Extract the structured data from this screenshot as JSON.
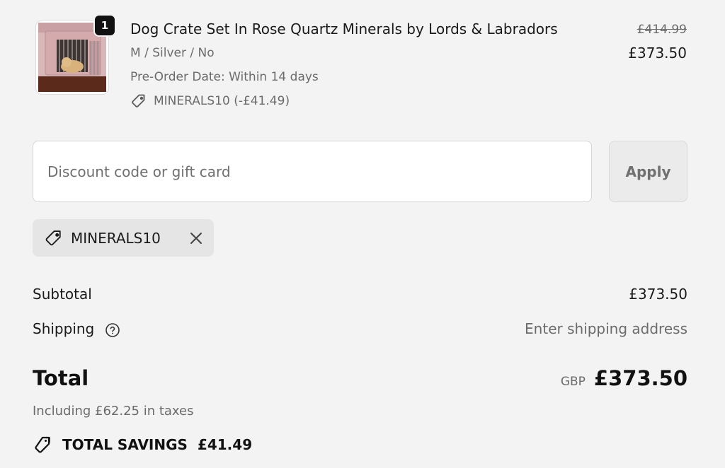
{
  "line_item": {
    "quantity": "1",
    "title": "Dog Crate Set In Rose Quartz Minerals by Lords & Labradors",
    "variant": "M / Silver / No",
    "preorder": "Pre-Order Date: Within 14 days",
    "discount": "MINERALS10 (-£41.49)",
    "original_price": "£414.99",
    "price": "£373.50",
    "thumbnail_icon": "dog-crate-product-image"
  },
  "discount_form": {
    "placeholder": "Discount code or gift card",
    "value": "",
    "apply_label": "Apply"
  },
  "applied_code": {
    "code": "MINERALS10",
    "remove_icon": "close-icon"
  },
  "summary": {
    "subtotal_label": "Subtotal",
    "subtotal_value": "£373.50",
    "shipping_label": "Shipping",
    "shipping_value": "Enter shipping address",
    "total_label": "Total",
    "currency": "GBP",
    "total_value": "£373.50",
    "taxes_note": "Including £62.25 in taxes",
    "savings_label": "TOTAL SAVINGS",
    "savings_value": "£41.49"
  },
  "colors": {
    "background": "#f3f3f3",
    "text": "#1a1a1a",
    "muted": "#6b6b6b",
    "badge": "#111111",
    "chip": "#e5e5e5"
  }
}
